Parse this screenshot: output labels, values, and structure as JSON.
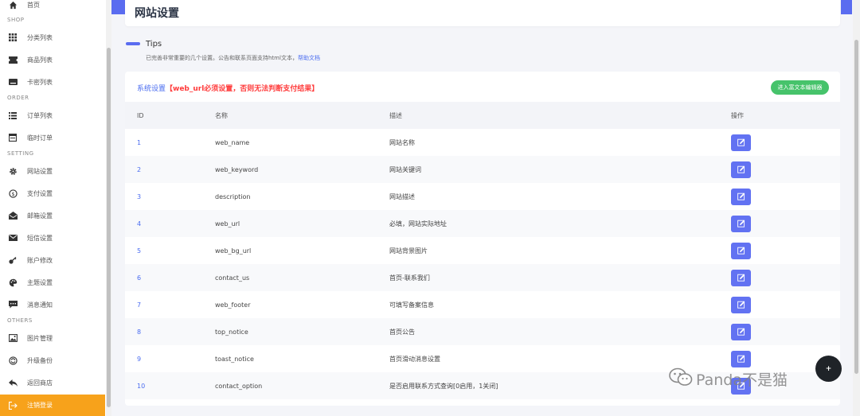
{
  "sidebar": {
    "top_item": {
      "label": "首页",
      "icon": "home-icon"
    },
    "sections": [
      {
        "title": "SHOP",
        "items": [
          {
            "label": "分类列表",
            "icon": "grid-icon"
          },
          {
            "label": "商品列表",
            "icon": "ticket-icon"
          },
          {
            "label": "卡密列表",
            "icon": "keyboard-icon"
          }
        ]
      },
      {
        "title": "ORDER",
        "items": [
          {
            "label": "订单列表",
            "icon": "list-icon"
          },
          {
            "label": "临时订单",
            "icon": "calendar-icon"
          }
        ]
      },
      {
        "title": "SETTING",
        "items": [
          {
            "label": "网站设置",
            "icon": "gear-icon"
          },
          {
            "label": "支付设置",
            "icon": "dollar-icon"
          },
          {
            "label": "邮箱设置",
            "icon": "mail-open-icon"
          },
          {
            "label": "短信设置",
            "icon": "envelope-icon"
          },
          {
            "label": "账户修改",
            "icon": "key-icon"
          },
          {
            "label": "主题设置",
            "icon": "palette-icon"
          },
          {
            "label": "消息通知",
            "icon": "message-icon"
          }
        ]
      },
      {
        "title": "OTHERS",
        "items": [
          {
            "label": "图片管理",
            "icon": "image-icon"
          },
          {
            "label": "升级备份",
            "icon": "upgrade-icon"
          },
          {
            "label": "返回商店",
            "icon": "reply-icon"
          },
          {
            "label": "注销登录",
            "icon": "logout-icon"
          }
        ]
      }
    ]
  },
  "header": {
    "title": "网站设置"
  },
  "tips": {
    "title": "Tips",
    "text": "已完善非常重要的几个设置。公告和联系页面支持html文本，",
    "link": "帮助文档"
  },
  "card": {
    "heading": "系统设置",
    "warning": "【web_url必须设置，否则无法判断支付结果】",
    "rich_button": "进入富文本编辑器"
  },
  "table": {
    "columns": [
      "ID",
      "名称",
      "描述",
      "操作"
    ],
    "rows": [
      {
        "id": "1",
        "name": "web_name",
        "desc": "网站名称"
      },
      {
        "id": "2",
        "name": "web_keyword",
        "desc": "网站关键词"
      },
      {
        "id": "3",
        "name": "description",
        "desc": "网站描述"
      },
      {
        "id": "4",
        "name": "web_url",
        "desc": "必填，网站实际地址"
      },
      {
        "id": "5",
        "name": "web_bg_url",
        "desc": "网站背景图片"
      },
      {
        "id": "6",
        "name": "contact_us",
        "desc": "首页-联系我们"
      },
      {
        "id": "7",
        "name": "web_footer",
        "desc": "可填写备案信息"
      },
      {
        "id": "8",
        "name": "top_notice",
        "desc": "首页公告"
      },
      {
        "id": "9",
        "name": "toast_notice",
        "desc": "首页滑动消息设置"
      },
      {
        "id": "10",
        "name": "contact_option",
        "desc": "是否启用联系方式查询[0启用，1关闭]"
      }
    ]
  },
  "float_button": {
    "label": "+"
  },
  "watermark": {
    "text": "Panda不是猫"
  },
  "colors": {
    "accent": "#5a6cf0",
    "active": "#f7a21b",
    "success": "#46c36b",
    "warning": "#ff3b3b"
  }
}
